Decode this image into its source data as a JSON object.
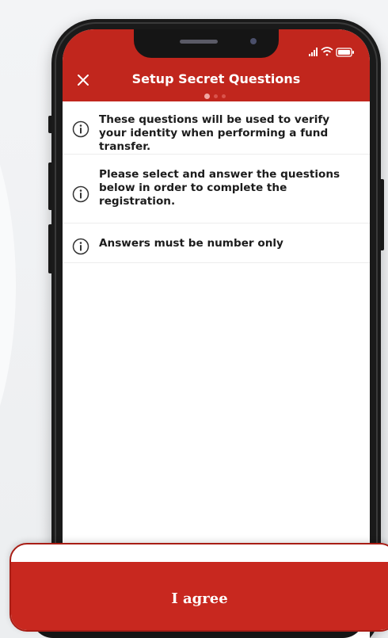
{
  "colors": {
    "brand": "#c1261d",
    "button": "#c8281f",
    "text": "#1c1c1c",
    "background": "#ffffff",
    "dot_active": "#f1a7a2",
    "dot_inactive": "#d9534c"
  },
  "status_bar": {
    "icons": [
      "signal-icon",
      "wifi-icon",
      "battery-icon"
    ]
  },
  "header": {
    "title": "Setup Secret Questions",
    "close_icon": "close-icon",
    "page_indicator": {
      "total": 3,
      "active": 1
    }
  },
  "info_items": [
    {
      "icon": "info-icon",
      "text": "These questions will be used to verify your identity when performing a fund transfer."
    },
    {
      "icon": "info-icon",
      "text": "Please select and answer the questions below in order to complete the registration."
    },
    {
      "icon": "info-icon",
      "text": "Answers must be number only"
    }
  ],
  "footer": {
    "agree_label": "I agree"
  }
}
